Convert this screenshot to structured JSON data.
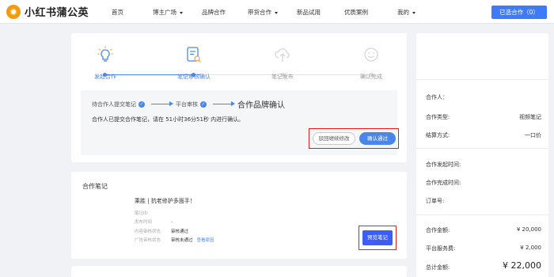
{
  "brand": {
    "name": "小红书蒲公英",
    "accent": "#3d7bfa"
  },
  "nav": {
    "items": [
      {
        "label": "首页",
        "dropdown": false
      },
      {
        "label": "博主广场",
        "dropdown": true
      },
      {
        "label": "品牌合作",
        "dropdown": false
      },
      {
        "label": "带货合作",
        "dropdown": true
      },
      {
        "label": "新品试用",
        "dropdown": false
      },
      {
        "label": "优质案例",
        "dropdown": false
      },
      {
        "label": "我的",
        "dropdown": true
      }
    ],
    "selected_button": "已选合作（0）"
  },
  "steps": [
    {
      "label": "发起合作",
      "icon": "lightbulb-icon",
      "active": true
    },
    {
      "label": "笔记审核确认",
      "icon": "document-search-icon",
      "active": true
    },
    {
      "label": "笔记发布",
      "icon": "cloud-upload-icon",
      "active": false
    },
    {
      "label": "确认完成",
      "icon": "smile-icon",
      "active": false
    }
  ],
  "status": {
    "flow": [
      {
        "label": "待合作人提交笔记",
        "checked": true
      },
      {
        "label": "平台审核",
        "checked": true
      }
    ],
    "current": "合作品牌确认",
    "message": "合作人已提交合作笔记，请在 51小时36分51秒 内进行确认。",
    "reject_label": "驳回继续修改",
    "confirm_label": "确认通过"
  },
  "note": {
    "section_title": "合作笔记",
    "name": "乘胜 | 抗老修护多面手！",
    "fields": [
      {
        "key": "笔记ID",
        "value": "",
        "link": ""
      },
      {
        "key": "发布时间",
        "value": "-",
        "link": ""
      },
      {
        "key": "内容审核状态",
        "value": "审核通过",
        "link": ""
      },
      {
        "key": "广告审核状态",
        "value": "审核未通过",
        "link": "查看原因"
      }
    ],
    "preview_label": "预览笔记"
  },
  "sidebar": {
    "partner_label": "合作人：",
    "partner_value": "",
    "type_label": "合作类型:",
    "type_value": "视频笔记",
    "settle_label": "结算方式:",
    "settle_value": "一口价",
    "start_label": "合作发起时间:",
    "end_label": "合作完成时间:",
    "order_label": "订单号:",
    "amount_label": "合作金额:",
    "amount_value": "¥ 20,000",
    "fee_label": "平台服务费:",
    "fee_value": "¥ 2,000",
    "total_label": "总计金额:",
    "total_value": "¥ 22,000"
  }
}
